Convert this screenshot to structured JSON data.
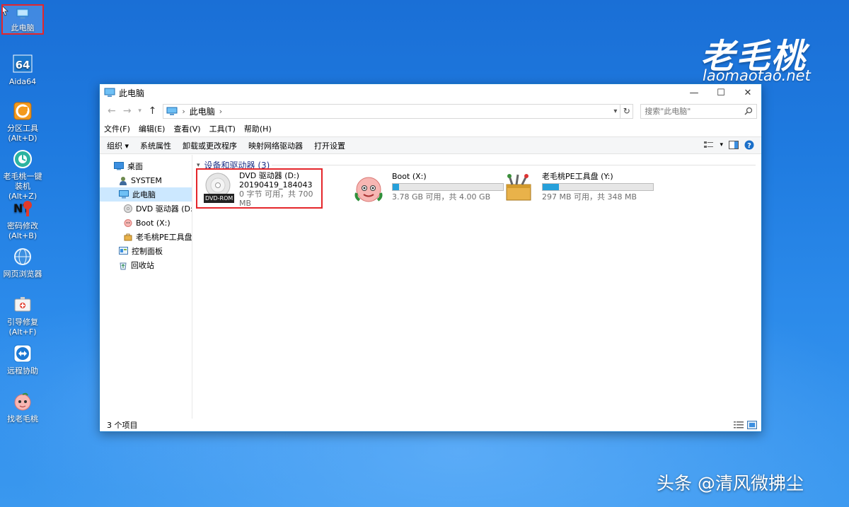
{
  "desktop": {
    "icons": [
      {
        "label": "此电脑",
        "icon": "computer-icon"
      },
      {
        "label": "Aida64",
        "icon": "aida64-icon"
      },
      {
        "label": "分区工具(Alt+D)",
        "icon": "partition-tool-icon"
      },
      {
        "label": "老毛桃一键装机(Alt+Z)",
        "icon": "installer-icon"
      },
      {
        "label": "密码修改(Alt+B)",
        "icon": "password-icon"
      },
      {
        "label": "网页浏览器",
        "icon": "browser-icon"
      },
      {
        "label": "引导修复(Alt+F)",
        "icon": "boot-repair-icon"
      },
      {
        "label": "远程协助",
        "icon": "remote-assist-icon"
      },
      {
        "label": "找老毛桃",
        "icon": "peach-icon"
      }
    ]
  },
  "watermark": {
    "logo_text": "老毛桃",
    "url": "laomaotao.net"
  },
  "caption": "头条 @清风微拂尘",
  "window": {
    "title": "此电脑",
    "controls": {
      "minimize": "—",
      "maximize": "☐",
      "close": "✕"
    },
    "address": {
      "crumb": "此电脑",
      "sep": "›"
    },
    "search": {
      "placeholder": "搜索\"此电脑\""
    },
    "menu": [
      "文件(F)",
      "编辑(E)",
      "查看(V)",
      "工具(T)",
      "帮助(H)"
    ],
    "commands": [
      "组织 ▾",
      "系统属性",
      "卸载或更改程序",
      "映射网络驱动器",
      "打开设置"
    ],
    "nav": [
      {
        "label": "桌面",
        "icon": "desktop-icon"
      },
      {
        "label": "SYSTEM",
        "icon": "user-icon"
      },
      {
        "label": "此电脑",
        "icon": "computer-icon"
      },
      {
        "label": "DVD 驱动器 (D:)",
        "icon": "dvd-icon"
      },
      {
        "label": "Boot (X:)",
        "icon": "peach-icon"
      },
      {
        "label": "老毛桃PE工具盘 (",
        "icon": "toolbox-icon"
      },
      {
        "label": "控制面板",
        "icon": "control-panel-icon"
      },
      {
        "label": "回收站",
        "icon": "recycle-bin-icon"
      }
    ],
    "group_header": "设备和驱动器 (3)",
    "drives": [
      {
        "name": "DVD 驱动器 (D:)",
        "label2": "20190419_184043",
        "space": "0 字节 可用，共 700 MB",
        "badge": "DVD-ROM",
        "used_fraction": null
      },
      {
        "name": "Boot (X:)",
        "space": "3.78 GB 可用，共 4.00 GB",
        "used_fraction": 0.055
      },
      {
        "name": "老毛桃PE工具盘 (Y:)",
        "space": "297 MB 可用，共 348 MB",
        "used_fraction": 0.147
      }
    ],
    "status": "3 个项目"
  },
  "colors": {
    "accent": "#1979ca",
    "highlight": "#e5262b",
    "bar_fill": "#26a0da",
    "group_header": "#1e3287"
  }
}
